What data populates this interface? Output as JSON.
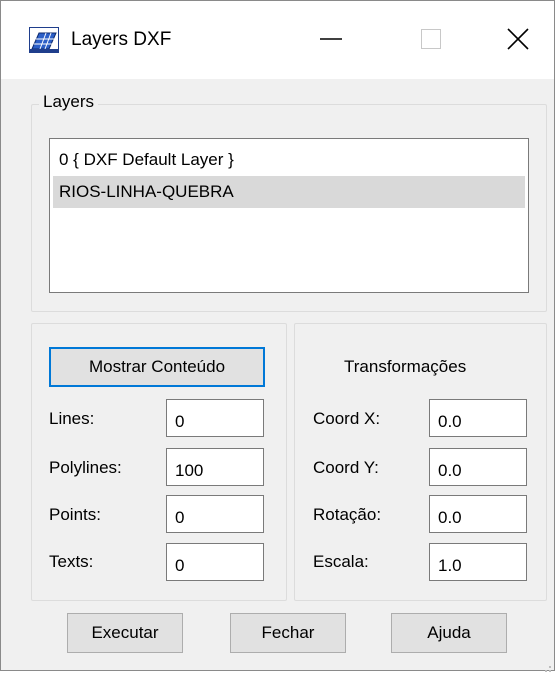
{
  "window": {
    "title": "Layers DXF",
    "icon": "grid-layers-icon"
  },
  "layers_group": {
    "legend": "Layers",
    "items": [
      {
        "label": "0 { DXF Default Layer }",
        "selected": false
      },
      {
        "label": "RIOS-LINHA-QUEBRA",
        "selected": true
      }
    ]
  },
  "content_group": {
    "button_label": "Mostrar Conteúdo",
    "fields": [
      {
        "label": "Lines:",
        "value": "0"
      },
      {
        "label": "Polylines:",
        "value": "100"
      },
      {
        "label": "Points:",
        "value": "0"
      },
      {
        "label": "Texts:",
        "value": "0"
      }
    ]
  },
  "transform_group": {
    "heading": "Transformações",
    "fields": [
      {
        "label": "Coord X:",
        "value": "0.0"
      },
      {
        "label": "Coord Y:",
        "value": "0.0"
      },
      {
        "label": "Rotação:",
        "value": "0.0"
      },
      {
        "label": "Escala:",
        "value": "1.0"
      }
    ]
  },
  "footer": {
    "execute_label": "Executar",
    "close_label": "Fechar",
    "help_label": "Ajuda"
  },
  "colors": {
    "dialog_bg": "#f0f0f0",
    "default_button_border": "#0078d7",
    "selected_item_bg": "#d9d9d9"
  }
}
